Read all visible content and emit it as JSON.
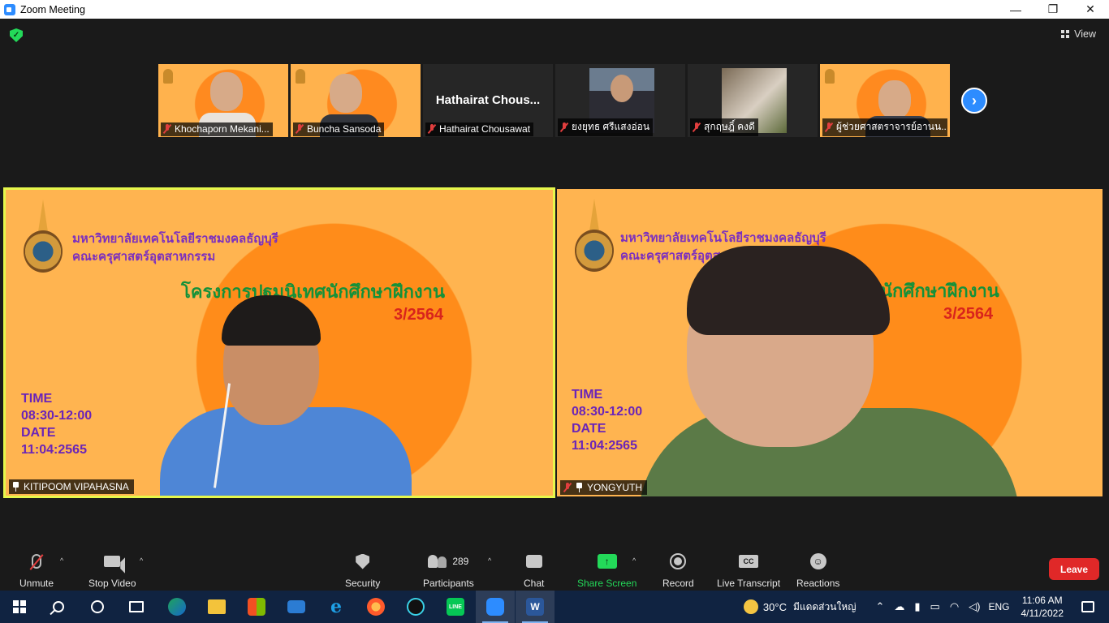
{
  "window": {
    "title": "Zoom Meeting",
    "controls": [
      "—",
      "❐",
      "✕"
    ]
  },
  "meeting": {
    "view_label": "View",
    "thumbnails": [
      {
        "name": "Khochaporn Mekani...",
        "muted": true
      },
      {
        "name": "Buncha Sansoda",
        "muted": true
      },
      {
        "name": "Hathairat Chousawat",
        "muted": true,
        "display_text": "Hathairat  Chous..."
      },
      {
        "name": "ยงยุทธ ศรีแสงอ่อน",
        "muted": true
      },
      {
        "name": "สุกฤษฎิ์ คงดี",
        "muted": true
      },
      {
        "name": "ผู้ช่วยศาสตราจารย์อานน...",
        "muted": true
      }
    ],
    "slide": {
      "university": "มหาวิทยาลัยเทคโนโลยีราชมงคลธัญบุรี",
      "faculty": "คณะครุศาสตร์อุตสาหกรรม",
      "project": "โครงการปฐมนิเทศนักศึกษาฝึกงาน",
      "project_partial": "นักศึกษาฝึกงาน",
      "term": "3/2564",
      "time_label": "TIME",
      "time_value": "08:30-12:00",
      "date_label": "DATE",
      "date_value": "11:04:2565",
      "date_value_partial": "11:04:2565"
    },
    "main_tiles": [
      {
        "name": "KITIPOOM VIPAHASNA",
        "pinned": true,
        "muted": false,
        "speaking": true
      },
      {
        "name": "YONGYUTH",
        "pinned": true,
        "muted": true,
        "speaking": false
      }
    ]
  },
  "toolbar": {
    "unmute": "Unmute",
    "stop_video": "Stop Video",
    "security": "Security",
    "participants": "Participants",
    "participant_count": "289",
    "chat": "Chat",
    "share_screen": "Share Screen",
    "record": "Record",
    "live_transcript": "Live Transcript",
    "reactions": "Reactions",
    "leave": "Leave",
    "cc_glyph": "CC",
    "caret": "^"
  },
  "taskbar": {
    "weather_temp": "30°C",
    "weather_desc": "มีแดดส่วนใหญ่",
    "language": "ENG",
    "time": "11:06 AM",
    "date": "4/11/2022",
    "apps": [
      "edge-dev",
      "file-explorer",
      "microsoft-store",
      "mail",
      "internet-explorer",
      "firefox",
      "webex",
      "line",
      "zoom",
      "word"
    ]
  },
  "colors": {
    "zoom_blue": "#2d8cff",
    "share_green": "#23d959",
    "leave_red": "#e02828",
    "speaker_border": "#e6f74b",
    "slide_orange": "#ff8c1a"
  }
}
